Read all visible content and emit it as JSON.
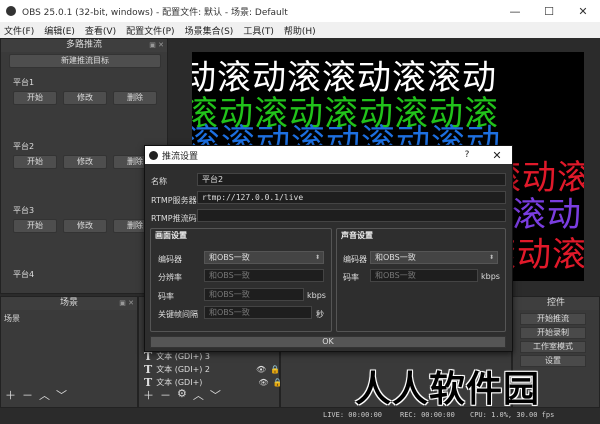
{
  "window": {
    "title": "OBS 25.0.1 (32-bit, windows) - 配置文件: 默认 - 场景: Default",
    "minimize": "—",
    "maximize": "☐",
    "close": "✕"
  },
  "menu": [
    "文件(F)",
    "编辑(E)",
    "查看(V)",
    "配置文件(P)",
    "场景集合(S)",
    "工具(T)",
    "帮助(H)"
  ],
  "multistream": {
    "title": "多路推流",
    "new_target": "新建推流目标",
    "platforms": [
      {
        "name": "平台1",
        "start": "开始",
        "edit": "修改",
        "delete": "删除"
      },
      {
        "name": "平台2",
        "start": "开始",
        "edit": "修改",
        "delete": "删除"
      },
      {
        "name": "平台3",
        "start": "开始",
        "edit": "修改",
        "delete": "删除"
      },
      {
        "name": "平台4"
      }
    ]
  },
  "preview": {
    "text_rows": [
      "动滚动滚滚动滚滚动",
      "滚动滚动滚动滚动滚",
      "滚滚动滚动滚动滚动",
      "动滚动滚动滚",
      "滚动滚动",
      "滚动滚"
    ]
  },
  "scenes": {
    "title": "场景",
    "items": [
      "场景"
    ]
  },
  "sources": {
    "items": [
      "文本 (GDI+) 3",
      "文本 (GDI+) 2",
      "文本 (GDI+)"
    ]
  },
  "controls": {
    "title": "控件",
    "buttons": [
      "开始推流",
      "开始录制",
      "工作室模式",
      "设置"
    ]
  },
  "dialog": {
    "title": "推流设置",
    "help": "?",
    "close": "✕",
    "name_label": "名称",
    "name_value": "平台2",
    "server_label": "RTMP服务器",
    "server_value": "rtmp://127.0.0.1/live",
    "key_label": "RTMP推流码",
    "key_value": "",
    "video": {
      "title": "画面设置",
      "encoder_label": "编码器",
      "encoder_value": "和OBS一致",
      "resolution_label": "分辨率",
      "resolution_placeholder": "和OBS一致",
      "bitrate_label": "码率",
      "bitrate_placeholder": "和OBS一致",
      "bitrate_unit": "kbps",
      "keyframe_label": "关键帧间隔",
      "keyframe_placeholder": "和OBS一致",
      "keyframe_unit": "秒"
    },
    "audio": {
      "title": "声音设置",
      "encoder_label": "编码器",
      "encoder_value": "和OBS一致",
      "bitrate_label": "码率",
      "bitrate_placeholder": "和OBS一致",
      "bitrate_unit": "kbps"
    },
    "ok": "OK"
  },
  "status": {
    "live": "LIVE: 00:00:00",
    "rec": "REC: 00:00:00",
    "cpu": "CPU: 1.0%, 30.00 fps"
  },
  "watermark": "人人软件园",
  "colors": {
    "green": "#21c21a",
    "blue": "#1d6fe0",
    "red": "#e0192a",
    "purple": "#7a3de0"
  }
}
